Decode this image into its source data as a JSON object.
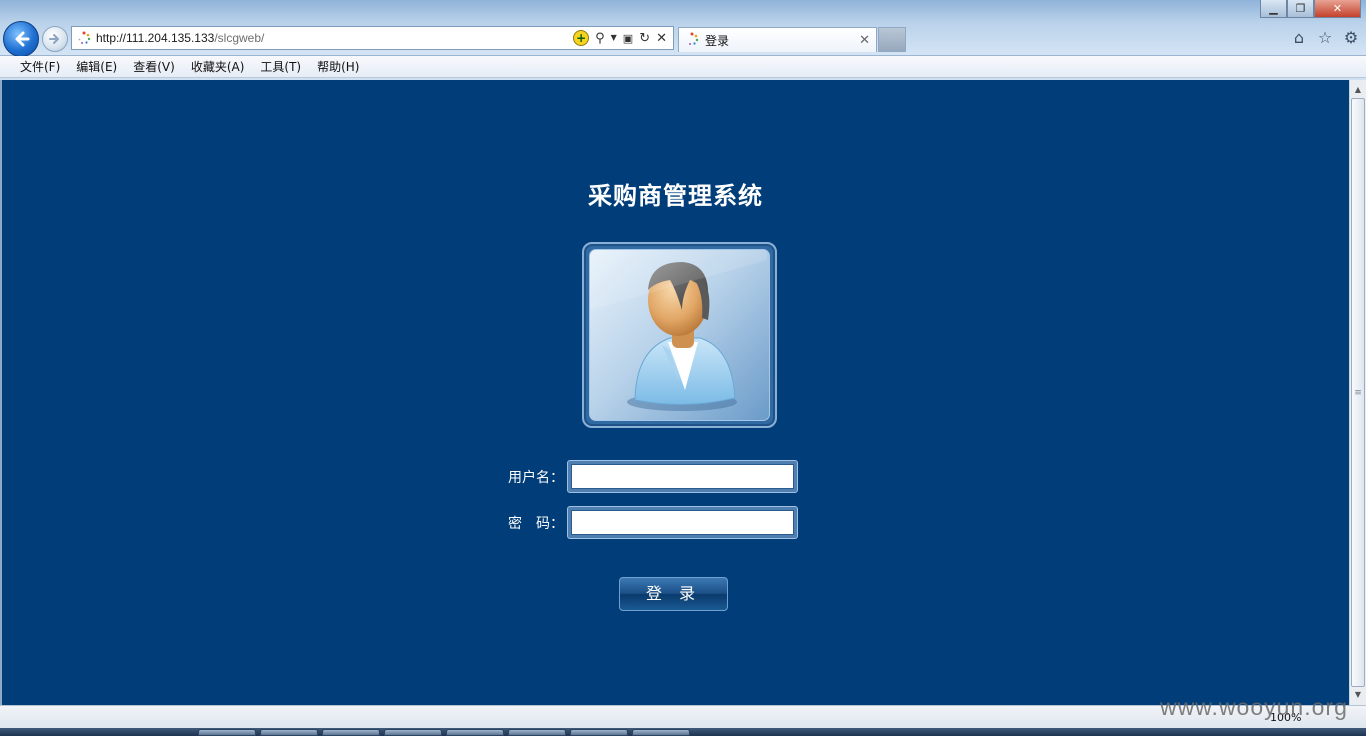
{
  "browser": {
    "address_host": "http://111.204.135.133",
    "address_path": "/slcgweb/",
    "tab_title": "登录",
    "window_buttons": {
      "minimize": "▁",
      "maximize": "❐",
      "close": "✕"
    },
    "right_icons": [
      "home-icon",
      "star-icon",
      "gear-icon"
    ]
  },
  "menu": {
    "items": [
      "文件(F)",
      "编辑(E)",
      "查看(V)",
      "收藏夹(A)",
      "工具(T)",
      "帮助(H)"
    ]
  },
  "page": {
    "title": "采购商管理系统",
    "username_label": "用户名：",
    "password_label": "密　码：",
    "login_button": "登 录",
    "username_value": "",
    "password_value": ""
  },
  "status": {
    "zoom": "100%",
    "watermark": "www.wooyun.org"
  },
  "colors": {
    "page_background": "#003d79",
    "title_text": "#ffffff",
    "button_gradient_top": "#3d79b4",
    "button_gradient_bottom": "#0a3a6c"
  }
}
